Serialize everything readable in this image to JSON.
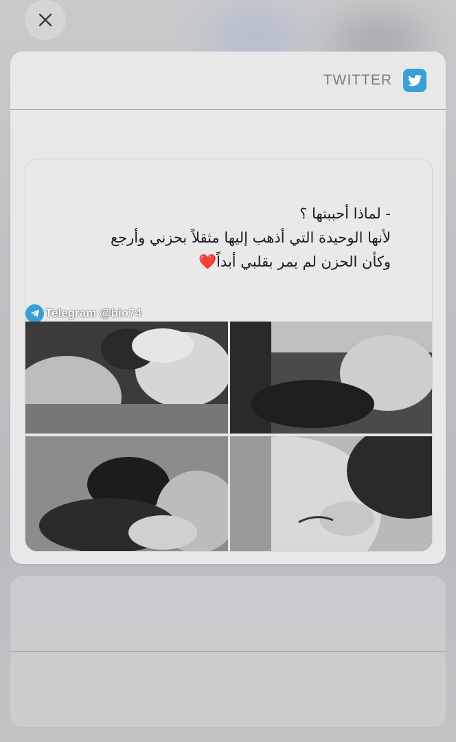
{
  "close": {
    "icon": "close-icon"
  },
  "card": {
    "app_name": "TWITTER",
    "app_icon": "twitter-icon",
    "post": {
      "lines": [
        "- لماذا أحببتها ؟",
        "لأنها الوحيدة التي أذهب إليها مثقلاً بحزني وأرجع",
        "وكأن الحزن لم يمر بقلبي أبداً"
      ],
      "emoji": "❤️",
      "watermark": "Telegram @bio74",
      "watermark_icon": "telegram-icon"
    }
  },
  "colors": {
    "twitter_blue": "#3a9fd5",
    "heart_red": "#c61f28"
  }
}
